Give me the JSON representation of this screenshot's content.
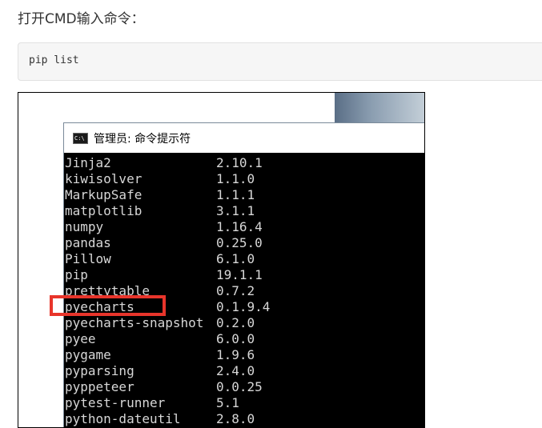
{
  "article": {
    "heading": "打开CMD输入命令：",
    "code": "pip list"
  },
  "cmd_window": {
    "title": "管理员: 命令提示符",
    "icon_text": "C:\\",
    "packages": [
      {
        "name": "Jinja2",
        "version": "2.10.1"
      },
      {
        "name": "kiwisolver",
        "version": "1.1.0"
      },
      {
        "name": "MarkupSafe",
        "version": "1.1.1"
      },
      {
        "name": "matplotlib",
        "version": "3.1.1"
      },
      {
        "name": "numpy",
        "version": "1.16.4"
      },
      {
        "name": "pandas",
        "version": "0.25.0"
      },
      {
        "name": "Pillow",
        "version": "6.1.0"
      },
      {
        "name": "pip",
        "version": "19.1.1"
      },
      {
        "name": "prettytable",
        "version": "0.7.2"
      },
      {
        "name": "pyecharts",
        "version": "0.1.9.4"
      },
      {
        "name": "pyecharts-snapshot",
        "version": "0.2.0"
      },
      {
        "name": "pyee",
        "version": "6.0.0"
      },
      {
        "name": "pygame",
        "version": "1.9.6"
      },
      {
        "name": "pyparsing",
        "version": "2.4.0"
      },
      {
        "name": "pyppeteer",
        "version": "0.0.25"
      },
      {
        "name": "pytest-runner",
        "version": "5.1"
      },
      {
        "name": "python-dateutil",
        "version": "2.8.0"
      }
    ],
    "highlight_color": "#e8352b",
    "console_bg": "#000000",
    "console_fg": "#d7d7d7"
  }
}
